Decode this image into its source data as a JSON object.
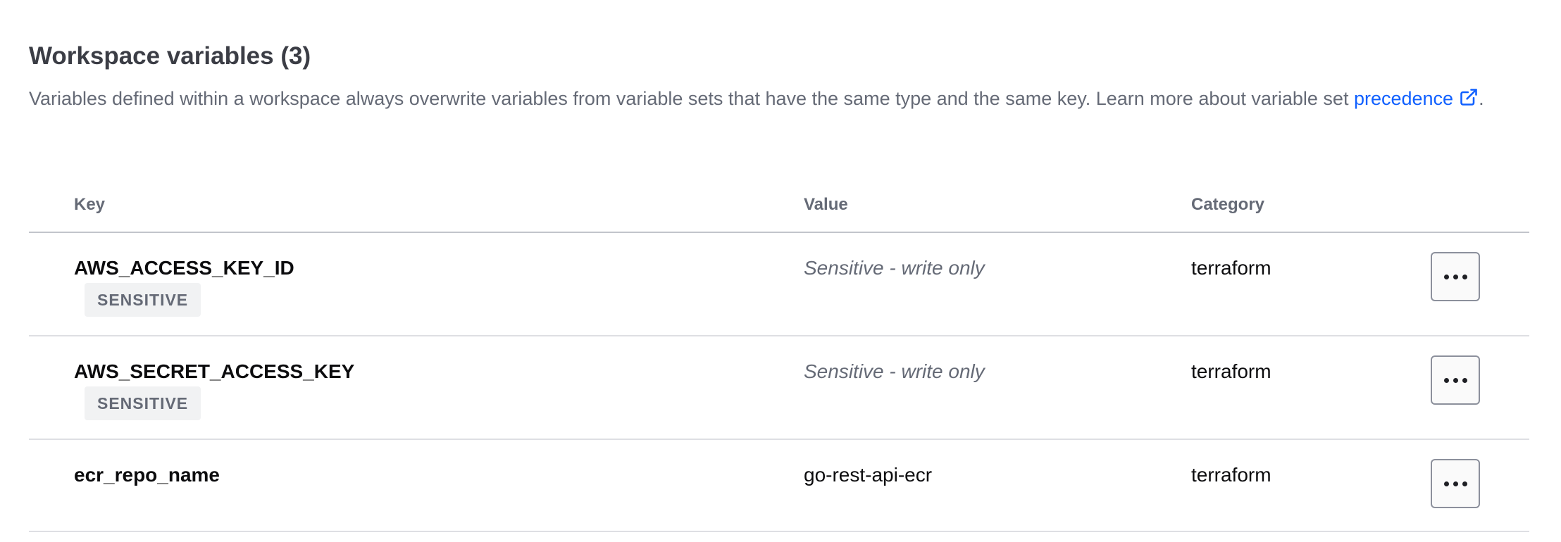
{
  "section": {
    "title": "Workspace variables (3)",
    "description": "Variables defined within a workspace always overwrite variables from variable sets that have the same type and the same key. Learn more about variable set ",
    "link_text": "precedence",
    "trailing": "."
  },
  "table": {
    "headers": {
      "key": "Key",
      "value": "Value",
      "category": "Category"
    },
    "rows": [
      {
        "key": "AWS_ACCESS_KEY_ID",
        "badge": "SENSITIVE",
        "value": "Sensitive - write only",
        "category": "terraform"
      },
      {
        "key": "AWS_SECRET_ACCESS_KEY",
        "badge": "SENSITIVE",
        "value": "Sensitive - write only",
        "category": "terraform"
      },
      {
        "key": "ecr_repo_name",
        "value": "go-rest-api-ecr",
        "category": "terraform"
      }
    ]
  },
  "icons": {
    "external_link": "external-link-icon",
    "more": "more-horizontal-icon"
  },
  "colors": {
    "link": "#1060ff",
    "muted_text": "#656a76",
    "badge_bg": "#f1f2f3"
  }
}
